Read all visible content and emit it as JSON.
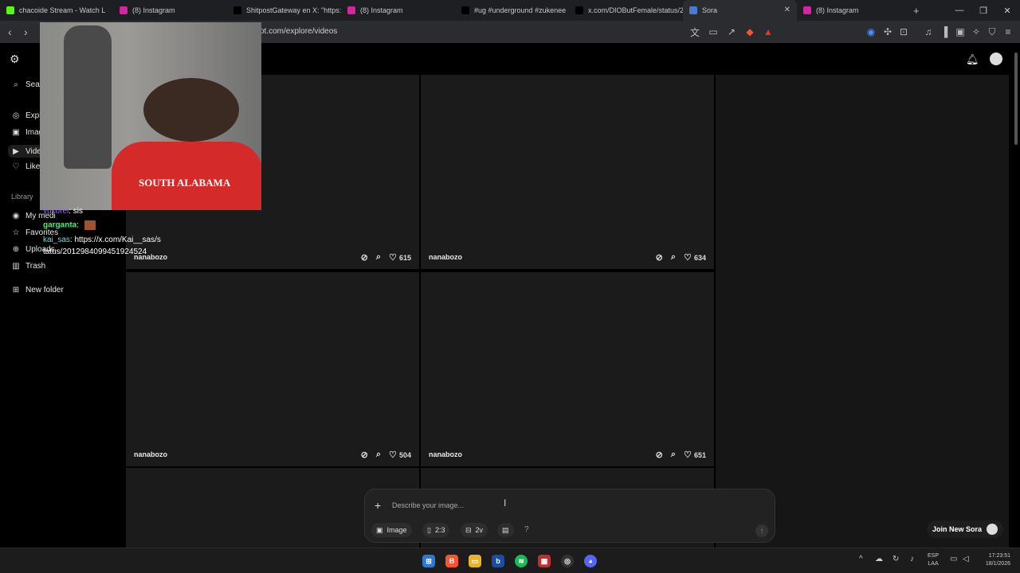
{
  "browser": {
    "tabs": [
      {
        "title": "chacoide Stream - Watch L",
        "icon": "kick-icon",
        "color": "#53fc18"
      },
      {
        "title": "(8) Instagram",
        "icon": "instagram-icon",
        "color": "#d6249f"
      },
      {
        "title": "ShitpostGateway en X: \"https:/",
        "icon": "x-icon",
        "color": "#000000"
      },
      {
        "title": "(8) Instagram",
        "icon": "instagram-icon",
        "color": "#d6249f"
      },
      {
        "title": "#ug #underground #zukenee",
        "icon": "tiktok-icon",
        "color": "#000000"
      },
      {
        "title": "x.com/DIOButFemale/status/2",
        "icon": "x-icon",
        "color": "#000000"
      },
      {
        "title": "Sora",
        "icon": "sora-icon",
        "color": "#4a7bd0",
        "active": true
      },
      {
        "title": "(8) Instagram",
        "icon": "instagram-icon",
        "color": "#d6249f"
      }
    ],
    "new_tab_label": "+",
    "url": "ot.com/explore/videos"
  },
  "sidebar": {
    "search_label": "Sear",
    "nav": [
      {
        "label": "Expl",
        "icon": "compass-icon"
      },
      {
        "label": "Imag",
        "icon": "image-icon"
      },
      {
        "label": "Vide",
        "icon": "video-icon",
        "active": true
      },
      {
        "label": "Like",
        "icon": "heart-icon"
      }
    ],
    "library_label": "Library",
    "library": [
      {
        "label": "My medi",
        "icon": "media-icon"
      },
      {
        "label": "Favorites",
        "icon": "star-icon"
      },
      {
        "label": "Uploads",
        "icon": "upload-icon"
      },
      {
        "label": "Trash",
        "icon": "trash-icon"
      }
    ],
    "new_folder": "New folder"
  },
  "chat_overlay": {
    "line1_user": "yukorei",
    "line1_text": ": sis",
    "line2_user": "garganta",
    "line2_text": ":",
    "line3_user": "kai_sas",
    "line3_text": ": https://x.com/Kai__sas/s",
    "line4_text": "tatus/2012984099451924524"
  },
  "cards": [
    {
      "author": "nanabozo",
      "likes": "615"
    },
    {
      "author": "nanabozo",
      "likes": "634"
    },
    {
      "author": "nanabozo",
      "likes": "504"
    },
    {
      "author": "nanabozo",
      "likes": "651"
    }
  ],
  "prompt": {
    "placeholder": "Describe your image...",
    "image_label": "Image",
    "ratio_label": "2:3",
    "variations_label": "2v",
    "help_label": "?"
  },
  "join_label": "Join New Sora",
  "taskbar": {
    "lang_top": "ESP",
    "lang_bottom": "LAA",
    "time": "17:23:51",
    "date": "18/1/2026"
  }
}
